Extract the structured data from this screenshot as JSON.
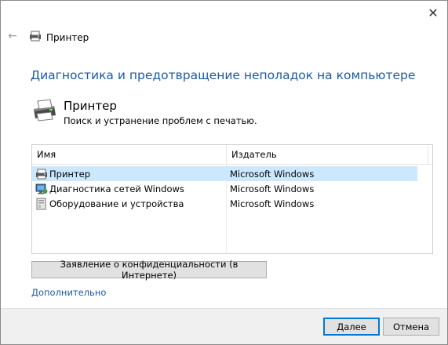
{
  "window": {
    "close_glyph": "✕",
    "back_glyph": "←"
  },
  "nav": {
    "title": "Принтер"
  },
  "heading": "Диагностика и предотвращение неполадок на компьютере",
  "troubleshooter": {
    "title": "Принтер",
    "subtitle": "Поиск и устранение проблем с печатью."
  },
  "list": {
    "columns": [
      "Имя",
      "Издатель"
    ],
    "rows": [
      {
        "name": "Принтер",
        "publisher": "Microsoft Windows",
        "icon": "printer-icon",
        "selected": true
      },
      {
        "name": "Диагностика сетей Windows",
        "publisher": "Microsoft Windows",
        "icon": "network-diagnostics-icon",
        "selected": false
      },
      {
        "name": "Оборудование и устройства",
        "publisher": "Microsoft Windows",
        "icon": "hardware-devices-icon",
        "selected": false
      }
    ]
  },
  "privacy_button": "Заявление о конфиденциальности (в Интернете)",
  "advanced_link": "Дополнительно",
  "footer": {
    "next_accel": "Д",
    "next_rest": "алее",
    "cancel": "Отмена"
  },
  "colors": {
    "heading": "#1a5aa6",
    "selection": "#cce8ff",
    "default_button_border": "#0078d7"
  }
}
